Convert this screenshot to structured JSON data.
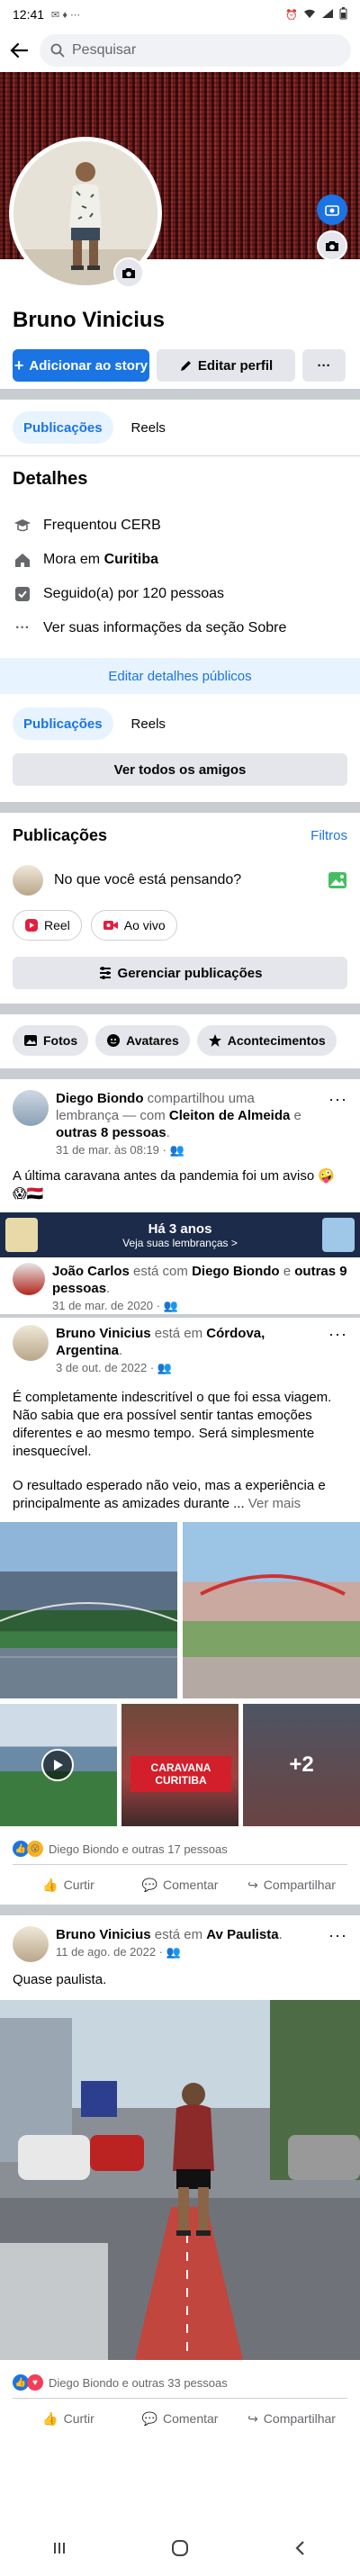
{
  "status_bar": {
    "time": "12:41"
  },
  "search": {
    "placeholder": "Pesquisar"
  },
  "profile": {
    "name": "Bruno Vinicius",
    "add_story": "Adicionar ao story",
    "edit_profile": "Editar perfil",
    "more": "···"
  },
  "tabs1": {
    "posts": "Publicações",
    "reels": "Reels"
  },
  "details": {
    "title": "Detalhes",
    "studied": "Frequentou CERB",
    "lives_prefix": "Mora em ",
    "lives_city": "Curitiba",
    "followed": "Seguido(a) por 120 pessoas",
    "about": "Ver suas informações da seção Sobre",
    "edit_public": "Editar detalhes públicos"
  },
  "tabs2": {
    "posts": "Publicações",
    "reels": "Reels"
  },
  "friends": {
    "see_all": "Ver todos os amigos"
  },
  "posts_section": {
    "title": "Publicações",
    "filters": "Filtros",
    "composer": "No que você está pensando?",
    "reel": "Reel",
    "live": "Ao vivo",
    "manage": "Gerenciar publicações"
  },
  "filter_chips": {
    "photos": "Fotos",
    "avatars": "Avatares",
    "events": "Acontecimentos"
  },
  "post1": {
    "author": "Diego Biondo",
    "action": " compartilhou uma lembrança — com ",
    "tag1": "Cleiton de Almeida",
    "joiner": " e ",
    "tag2": "outras 8 pessoas",
    "end": ".",
    "time": "31 de mar. às 08:19 ·",
    "text": "A última caravana antes da pandemia foi um aviso 🤪😱🇾🇪",
    "memory_title": "Há 3 anos",
    "memory_sub": "Veja suas lembranças >"
  },
  "shared1": {
    "author": "João Carlos",
    "mid": " está com ",
    "tag1": "Diego Biondo",
    "joiner": " e ",
    "tag2": "outras 9 pessoas",
    "end": ".",
    "time": "31 de mar. de 2020 ·"
  },
  "post2": {
    "author": "Bruno Vinicius",
    "mid": " está em ",
    "place": "Córdova, Argentina",
    "end": ".",
    "time": "3 de out. de 2022 ·",
    "text1": "É completamente indescritível o que foi essa viagem. Não sabia que era possível sentir tantas emoções diferentes e ao mesmo tempo. Será simplesmente inesquecível.",
    "text2": "O resultado esperado não veio, mas a experiência e principalmente as amizades durante ...",
    "see_more": " Ver mais",
    "banner": "CARAVANA CURITIBA",
    "more_photos": "+2",
    "reactions": "Diego Biondo e outras 17 pessoas",
    "like": "Curtir",
    "comment": "Comentar",
    "share": "Compartilhar"
  },
  "post3": {
    "author": "Bruno Vinicius",
    "mid": " está em ",
    "place": "Av Paulista",
    "end": ".",
    "time": "11 de ago. de 2022 ·",
    "text": "Quase paulista.",
    "reactions": "Diego Biondo e outras 33 pessoas",
    "like": "Curtir",
    "comment": "Comentar",
    "share": "Compartilhar"
  },
  "colors": {
    "primary": "#1b74e4",
    "light_primary": "#e7f3ff",
    "grey_button": "#e4e6eb"
  }
}
